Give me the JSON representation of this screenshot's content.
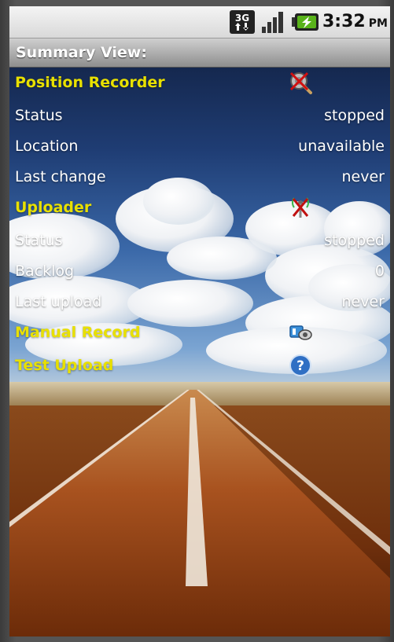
{
  "status_bar": {
    "network": "3G",
    "time": "3:32",
    "ampm": "PM"
  },
  "title": "Summary View:",
  "position_recorder": {
    "heading": "Position Recorder",
    "icon": "recorder-off-icon",
    "rows": [
      {
        "label": "Status",
        "value": "stopped"
      },
      {
        "label": "Location",
        "value": "unavailable"
      },
      {
        "label": "Last change",
        "value": "never"
      }
    ]
  },
  "uploader": {
    "heading": "Uploader",
    "icon": "antenna-off-icon",
    "rows": [
      {
        "label": "Status",
        "value": "stopped"
      },
      {
        "label": "Backlog",
        "value": "0"
      },
      {
        "label": "Last upload",
        "value": "never"
      }
    ]
  },
  "manual_record": {
    "label": "Manual Record",
    "icon": "record-icon"
  },
  "test_upload": {
    "label": "Test Upload",
    "icon": "help-icon"
  },
  "colors": {
    "section_heading": "#e8e000",
    "text": "#ffffff",
    "titlebar": "#a8a8a8"
  }
}
